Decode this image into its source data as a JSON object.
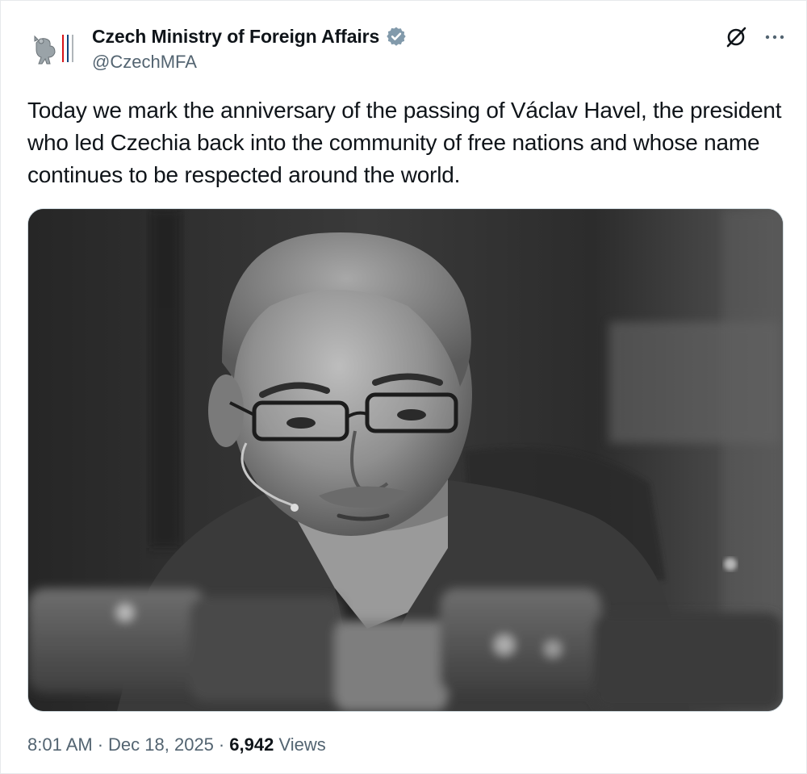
{
  "post": {
    "author_name": "Czech Ministry of Foreign Affairs",
    "author_handle": "@CzechMFA",
    "text": "Today we mark the anniversary of the passing of Václav Havel, the president who led Czechia back into the community of free nations and whose name continues to be respected around the world.",
    "time": "8:01 AM",
    "separator": "·",
    "date": "Dec 18, 2025",
    "views_count": "6,942",
    "views_label": "Views"
  },
  "icons": {
    "avatar": "czech-coat-of-arms-logo",
    "verified": "verified-badge-icon",
    "grok": "grok-icon",
    "more": "more-options-icon"
  },
  "colors": {
    "text_primary": "#0f1419",
    "text_secondary": "#536471",
    "verified_badge": "#829aab",
    "border": "#cfd9de"
  },
  "media": {
    "type": "photo",
    "style": "black-and-white"
  }
}
